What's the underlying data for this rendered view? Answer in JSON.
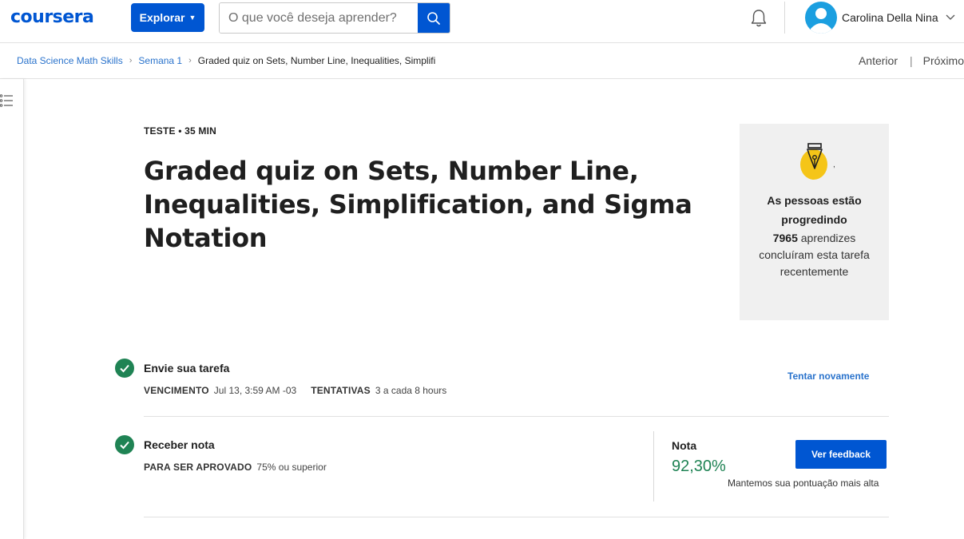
{
  "header": {
    "logo": "coursera",
    "explore_label": "Explorar",
    "search_placeholder": "O que você deseja aprender?",
    "user_name": "Carolina Della Nina"
  },
  "breadcrumb": {
    "items": [
      "Data Science Math Skills",
      "Semana 1"
    ],
    "current": "Graded quiz on Sets, Number Line, Inequalities, Simplifi"
  },
  "nav": {
    "previous": "Anterior",
    "next": "Próximo"
  },
  "item": {
    "kicker": "TESTE • 35 MIN",
    "title": "Graded quiz on Sets, Number Line, Inequalities, Simplification, and Sigma Notation"
  },
  "promo": {
    "title": "As pessoas estão progredindo",
    "count": "7965",
    "text": "aprendizes concluíram esta tarefa recentemente"
  },
  "submit": {
    "title": "Envie sua tarefa",
    "due_label": "VENCIMENTO",
    "due_value": "Jul 13, 3:59 AM -03",
    "attempts_label": "TENTATIVAS",
    "attempts_value": "3 a cada 8 hours",
    "retry_label": "Tentar novamente"
  },
  "grade": {
    "title": "Receber nota",
    "pass_label": "PARA SER APROVADO",
    "pass_value": "75% ou superior",
    "grade_label": "Nota",
    "grade_value": "92,30%",
    "feedback_label": "Ver feedback",
    "note": "Mantemos sua pontuação mais alta"
  },
  "colors": {
    "brand": "#0056d2",
    "success": "#1f8354",
    "link": "#2a73cc"
  },
  "icons": [
    "search-icon",
    "bell-icon",
    "user-avatar-icon",
    "chevron-down-icon",
    "menu-list-icon",
    "pen-nib-icon",
    "check-icon"
  ]
}
